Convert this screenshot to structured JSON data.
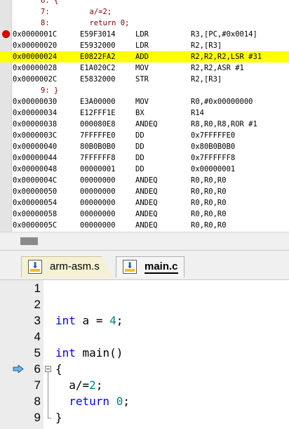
{
  "disassembly": {
    "lines": [
      {
        "kind": "src",
        "text": "6: {"
      },
      {
        "kind": "src",
        "text": "7:         a/=2;"
      },
      {
        "kind": "src",
        "text": "8:         return 0;"
      },
      {
        "kind": "ins",
        "addr": "0x0000001C",
        "opcode": "E59F3014",
        "mnemonic": "LDR",
        "args": "R3,[PC,#0x0014]",
        "breakpoint": true
      },
      {
        "kind": "ins",
        "addr": "0x00000020",
        "opcode": "E5932000",
        "mnemonic": "LDR",
        "args": "R2,[R3]"
      },
      {
        "kind": "ins",
        "addr": "0x00000024",
        "opcode": "E0822FA2",
        "mnemonic": "ADD",
        "args": "R2,R2,R2,LSR #31",
        "current": true
      },
      {
        "kind": "ins",
        "addr": "0x00000028",
        "opcode": "E1A020C2",
        "mnemonic": "MOV",
        "args": "R2,R2,ASR #1"
      },
      {
        "kind": "ins",
        "addr": "0x0000002C",
        "opcode": "E5832000",
        "mnemonic": "STR",
        "args": "R2,[R3]"
      },
      {
        "kind": "src",
        "text": "9: }"
      },
      {
        "kind": "ins",
        "addr": "0x00000030",
        "opcode": "E3A00000",
        "mnemonic": "MOV",
        "args": "R0,#0x00000000"
      },
      {
        "kind": "ins",
        "addr": "0x00000034",
        "opcode": "E12FFF1E",
        "mnemonic": "BX",
        "args": "R14"
      },
      {
        "kind": "ins",
        "addr": "0x00000038",
        "opcode": "000080E8",
        "mnemonic": "ANDEQ",
        "args": "R8,R0,R8,ROR #1"
      },
      {
        "kind": "ins",
        "addr": "0x0000003C",
        "opcode": "7FFFFFE0",
        "mnemonic": "DD",
        "args": "0x7FFFFFE0"
      },
      {
        "kind": "ins",
        "addr": "0x00000040",
        "opcode": "80B0B0B0",
        "mnemonic": "DD",
        "args": "0x80B0B0B0"
      },
      {
        "kind": "ins",
        "addr": "0x00000044",
        "opcode": "7FFFFFF8",
        "mnemonic": "DD",
        "args": "0x7FFFFFF8"
      },
      {
        "kind": "ins",
        "addr": "0x00000048",
        "opcode": "00000001",
        "mnemonic": "DD",
        "args": "0x00000001"
      },
      {
        "kind": "ins",
        "addr": "0x0000004C",
        "opcode": "00000000",
        "mnemonic": "ANDEQ",
        "args": "R0,R0,R0"
      },
      {
        "kind": "ins",
        "addr": "0x00000050",
        "opcode": "00000000",
        "mnemonic": "ANDEQ",
        "args": "R0,R0,R0"
      },
      {
        "kind": "ins",
        "addr": "0x00000054",
        "opcode": "00000000",
        "mnemonic": "ANDEQ",
        "args": "R0,R0,R0"
      },
      {
        "kind": "ins",
        "addr": "0x00000058",
        "opcode": "00000000",
        "mnemonic": "ANDEQ",
        "args": "R0,R0,R0"
      },
      {
        "kind": "ins",
        "addr": "0x0000005C",
        "opcode": "00000000",
        "mnemonic": "ANDEQ",
        "args": "R0,R0,R0"
      }
    ],
    "current_line_color": "#ffff00",
    "breakpoint_color": "#e00000",
    "source_line_color": "#800000"
  },
  "tabs": [
    {
      "label": "arm-asm.s",
      "active": false,
      "icon": "source-file-icon"
    },
    {
      "label": "main.c",
      "active": true,
      "icon": "source-file-icon"
    }
  ],
  "editor": {
    "lines": [
      {
        "num": "1",
        "code": ""
      },
      {
        "num": "2",
        "code": ""
      },
      {
        "num": "3",
        "code": "int a = 4;"
      },
      {
        "num": "4",
        "code": ""
      },
      {
        "num": "5",
        "code": "int main()"
      },
      {
        "num": "6",
        "code": "{",
        "current": true
      },
      {
        "num": "7",
        "code": "  a/=2;"
      },
      {
        "num": "8",
        "code": "  return 0;"
      },
      {
        "num": "9",
        "code": "}"
      }
    ],
    "keyword_color": "#0000ff",
    "number_color": "#008080"
  }
}
